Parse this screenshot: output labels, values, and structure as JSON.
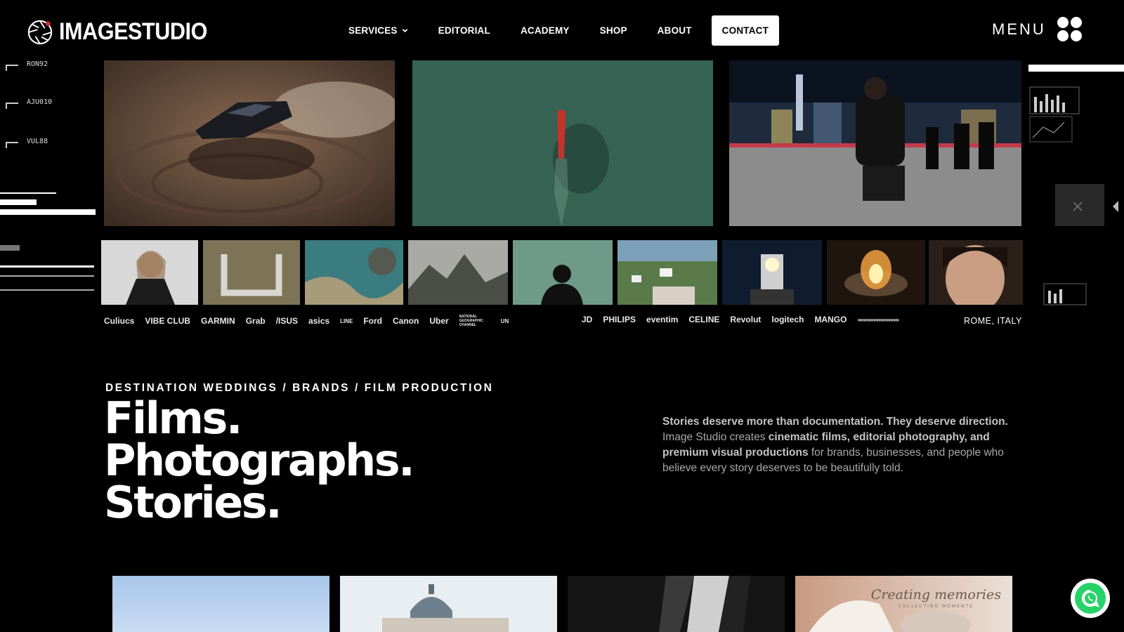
{
  "brand": {
    "name": "IMAGESTUDIO",
    "logo_icon": "aperture-icon",
    "accent": "#e0262a"
  },
  "nav": {
    "items": [
      {
        "label": "SERVICES",
        "has_dropdown": true
      },
      {
        "label": "EDITORIAL"
      },
      {
        "label": "ACADEMY"
      },
      {
        "label": "SHOP"
      },
      {
        "label": "ABOUT"
      }
    ],
    "contact_label": "CONTACT",
    "menu_label": "MENU"
  },
  "hero": {
    "hud_labels": [
      "RON92",
      "AJU010",
      "VUL88"
    ],
    "big_frames": [
      "drifting-sports-car-aerial",
      "boat-on-green-water-aerial",
      "rapper-on-rooftop-night-city"
    ],
    "thumbnails": [
      "woman-portrait",
      "cars-letter-formation-aerial",
      "coastline-aerial",
      "limestone-bay-mountains",
      "silhouette-on-water",
      "seaside-village",
      "lighthouse-night",
      "fire-pit",
      "woman-closeup-portrait"
    ],
    "brand_logos_left": [
      "Culiucs",
      "VIBE CLUB",
      "GARMIN",
      "Grab",
      "/ISUS",
      "asics",
      "LINE",
      "Ford",
      "Canon",
      "Uber",
      "NATIONAL GEOGRAPHIC CHANNEL",
      "UN"
    ],
    "brand_logos_right": [
      "JD",
      "PHILIPS",
      "eventim",
      "CELINE",
      "Revolut",
      "logitech",
      "MANGO",
      "»»»»»»»»»»»»»»»»»"
    ],
    "location": "ROME, ITALY"
  },
  "intro": {
    "eyebrow": "DESTINATION WEDDINGS / BRANDS / FILM PRODUCTION",
    "headline": [
      "Films.",
      "Photographs.",
      "Stories."
    ],
    "paragraph": {
      "lead": "Stories deserve more than documentation. They deserve direction.",
      "part1": " Image Studio creates ",
      "bold1": "cinematic films, editorial photography, and premium visual productions",
      "part2": " for brands, businesses, and people who believe every story deserves to be beautifully told."
    }
  },
  "gallery": {
    "items": [
      "blue-sky",
      "st-peters-basilica-dome",
      "black-and-white-suit",
      "bride-wedding-dress"
    ],
    "caption_title": "Creating memories",
    "caption_sub": "COLLECTING MOMENTS"
  },
  "floating": {
    "whatsapp_icon": "whatsapp-icon",
    "whatsapp_color": "#25d366"
  }
}
